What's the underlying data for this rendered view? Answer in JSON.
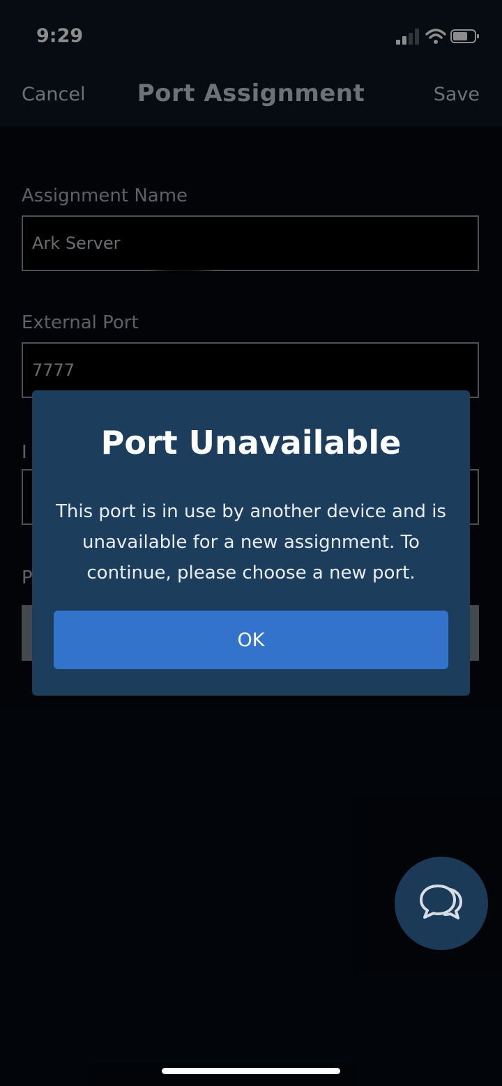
{
  "status_bar": {
    "time": "9:29",
    "icons": [
      "cellular-signal-icon",
      "wifi-icon",
      "battery-icon"
    ]
  },
  "nav": {
    "cancel_label": "Cancel",
    "title": "Port Assignment",
    "save_label": "Save"
  },
  "form": {
    "assignment_name": {
      "label": "Assignment Name",
      "value": "Ark Server"
    },
    "external_port": {
      "label": "External Port",
      "value": "7777"
    },
    "internal_port_label_fragment": "I",
    "protocol_label_fragment": "P"
  },
  "dialog": {
    "title": "Port Unavailable",
    "message": "This port is in use by another device and is unavailable for a new assignment. To continue, please choose a new port.",
    "ok_label": "OK"
  },
  "chat": {
    "icon": "chat-bubbles-icon"
  },
  "colors": {
    "background": "#040910",
    "header": "#0b1622",
    "dialog": "#1d3d5d",
    "primary_button": "#3373cb",
    "chat_button": "#1b3a57"
  }
}
